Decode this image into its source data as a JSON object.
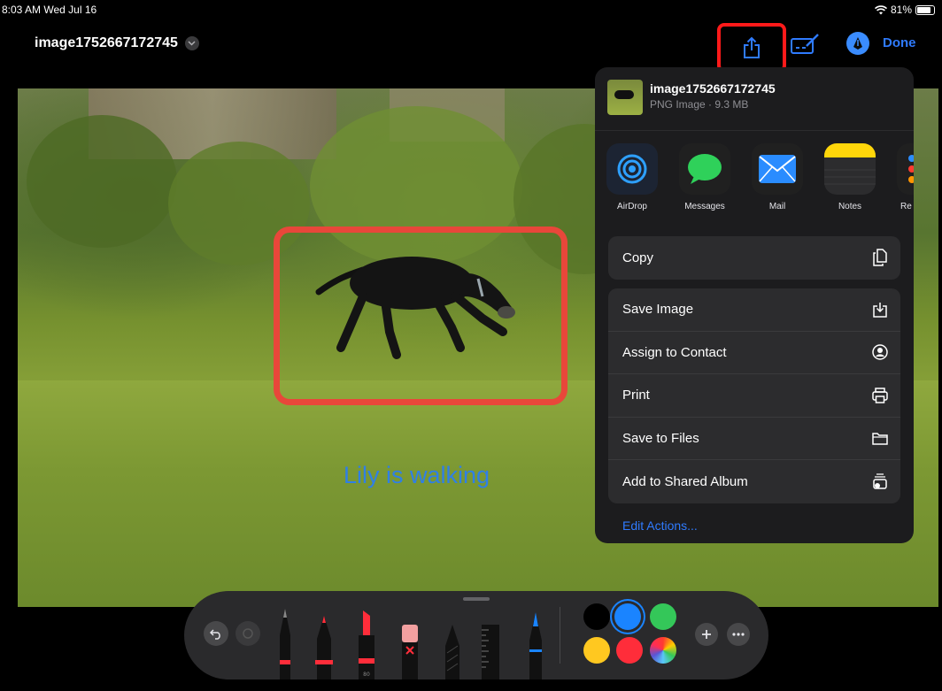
{
  "status": {
    "time": "8:03 AM  Wed Jul 16",
    "battery": "81%",
    "battery_level": 0.81
  },
  "header": {
    "title": "image1752667172745",
    "done_label": "Done",
    "icons": [
      "share-icon",
      "markup-icon",
      "pen-icon",
      "chevron-down-icon"
    ]
  },
  "image": {
    "caption": "Lily is walking"
  },
  "share_sheet": {
    "file_name": "image1752667172745",
    "file_info": "PNG Image · 9.3 MB",
    "apps": [
      {
        "label": "AirDrop"
      },
      {
        "label": "Messages"
      },
      {
        "label": "Mail"
      },
      {
        "label": "Notes"
      },
      {
        "label": "Re"
      }
    ],
    "copy_label": "Copy",
    "actions": [
      {
        "label": "Save Image"
      },
      {
        "label": "Assign to Contact"
      },
      {
        "label": "Print"
      },
      {
        "label": "Save to Files"
      },
      {
        "label": "Add to Shared Album"
      }
    ],
    "edit_actions_label": "Edit Actions..."
  },
  "toolbar": {
    "marker_label": "80",
    "colors": {
      "black": "#000000",
      "blue": "#1a84ff",
      "green": "#34c759",
      "yellow": "#ffc820",
      "red": "#ff2d3a"
    }
  }
}
